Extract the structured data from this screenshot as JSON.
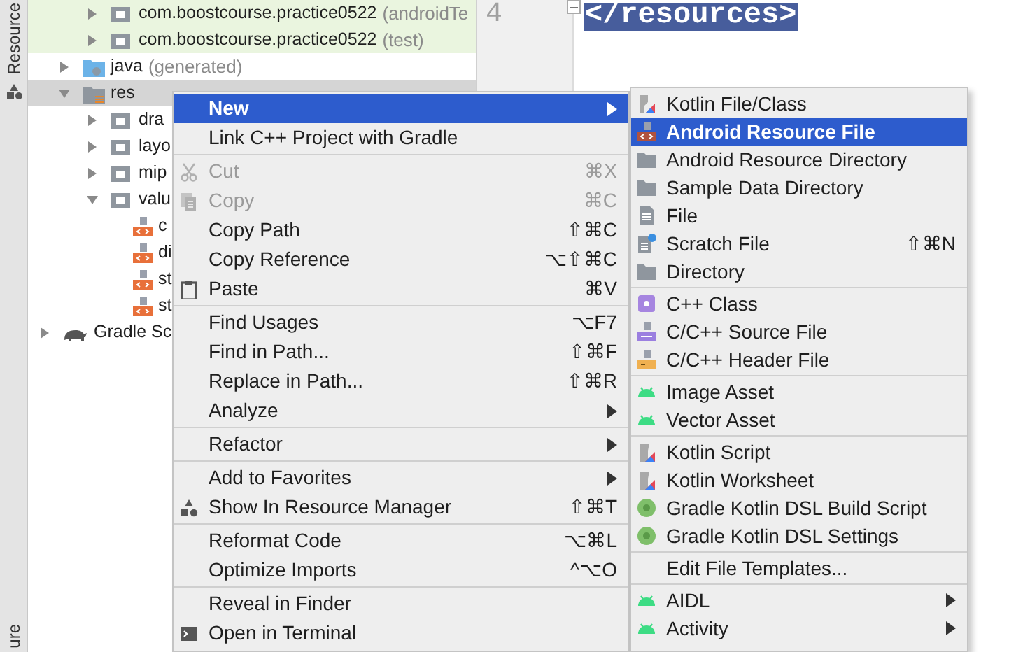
{
  "sidebar_tab": {
    "label": "Resource",
    "bottom_label": "ure"
  },
  "editor": {
    "line_number": "4",
    "code": "</resources>",
    "selected": true
  },
  "project_tree": {
    "java_packages": [
      {
        "label": "com.boostcourse.practice0522",
        "suffix": "(androidTe",
        "kind": "test-package",
        "expanded": false,
        "selected": false
      },
      {
        "label": "com.boostcourse.practice0522",
        "suffix": "(test)",
        "kind": "test-package",
        "expanded": false,
        "selected": false
      }
    ],
    "module_folders": [
      {
        "label": "java",
        "suffix": "(generated)",
        "kind": "generated-folder",
        "expanded": false,
        "selected": false
      },
      {
        "label": "res",
        "kind": "res-folder",
        "expanded": true,
        "selected": true,
        "children": [
          {
            "label": "dra",
            "kind": "folder",
            "expanded": false,
            "selected": false
          },
          {
            "label": "layo",
            "kind": "folder",
            "expanded": false,
            "selected": false
          },
          {
            "label": "mip",
            "kind": "folder",
            "expanded": false,
            "selected": false
          },
          {
            "label": "valu",
            "kind": "folder",
            "expanded": true,
            "selected": false,
            "children": [
              {
                "label": "c",
                "kind": "xml-file",
                "selected": false
              },
              {
                "label": "di",
                "kind": "xml-file",
                "selected": false
              },
              {
                "label": "st",
                "kind": "xml-file",
                "selected": false
              },
              {
                "label": "st",
                "kind": "xml-file",
                "selected": false
              }
            ]
          }
        ]
      }
    ],
    "root_items": [
      {
        "label": "Gradle Sc",
        "kind": "gradle",
        "expanded": false,
        "selected": false
      }
    ]
  },
  "context_menu": {
    "groups": [
      [
        {
          "label": "New",
          "kind": "none",
          "submenu": true,
          "disabled": false,
          "selected": true
        },
        {
          "label": "Link C++ Project with Gradle",
          "kind": "none",
          "submenu": false,
          "disabled": false,
          "selected": false
        }
      ],
      [
        {
          "label": "Cut",
          "kind": "scissors",
          "shortcut": "⌘X",
          "submenu": false,
          "disabled": true,
          "selected": false
        },
        {
          "label": "Copy",
          "kind": "copy",
          "shortcut": "⌘C",
          "submenu": false,
          "disabled": true,
          "selected": false
        },
        {
          "label": "Copy Path",
          "kind": "none",
          "shortcut": "⇧⌘C",
          "submenu": false,
          "disabled": false,
          "selected": false
        },
        {
          "label": "Copy Reference",
          "kind": "none",
          "shortcut": "⌥⇧⌘C",
          "submenu": false,
          "disabled": false,
          "selected": false
        },
        {
          "label": "Paste",
          "kind": "clipboard",
          "shortcut": "⌘V",
          "submenu": false,
          "disabled": false,
          "selected": false
        }
      ],
      [
        {
          "label": "Find Usages",
          "kind": "none",
          "shortcut": "⌥F7",
          "submenu": false,
          "disabled": false,
          "selected": false
        },
        {
          "label": "Find in Path...",
          "kind": "none",
          "shortcut": "⇧⌘F",
          "submenu": false,
          "disabled": false,
          "selected": false
        },
        {
          "label": "Replace in Path...",
          "kind": "none",
          "shortcut": "⇧⌘R",
          "submenu": false,
          "disabled": false,
          "selected": false
        },
        {
          "label": "Analyze",
          "kind": "none",
          "submenu": true,
          "disabled": false,
          "selected": false
        }
      ],
      [
        {
          "label": "Refactor",
          "kind": "none",
          "submenu": true,
          "disabled": false,
          "selected": false
        }
      ],
      [
        {
          "label": "Add to Favorites",
          "kind": "none",
          "submenu": true,
          "disabled": false,
          "selected": false
        },
        {
          "label": "Show In Resource Manager",
          "kind": "shapes",
          "shortcut": "⇧⌘T",
          "submenu": false,
          "disabled": false,
          "selected": false
        }
      ],
      [
        {
          "label": "Reformat Code",
          "kind": "none",
          "shortcut": "⌥⌘L",
          "submenu": false,
          "disabled": false,
          "selected": false
        },
        {
          "label": "Optimize Imports",
          "kind": "none",
          "shortcut": "^⌥O",
          "submenu": false,
          "disabled": false,
          "selected": false
        }
      ],
      [
        {
          "label": "Reveal in Finder",
          "kind": "none",
          "submenu": false,
          "disabled": false,
          "selected": false
        },
        {
          "label": "Open in Terminal",
          "kind": "terminal",
          "submenu": false,
          "disabled": false,
          "selected": false
        }
      ]
    ]
  },
  "submenu": {
    "groups": [
      [
        {
          "label": "Kotlin File/Class",
          "kind": "kotlin",
          "submenu": false,
          "disabled": false,
          "selected": false
        },
        {
          "label": "Android Resource File",
          "kind": "resource-file",
          "submenu": false,
          "disabled": false,
          "selected": true
        },
        {
          "label": "Android Resource Directory",
          "kind": "folder",
          "submenu": false,
          "disabled": false,
          "selected": false
        },
        {
          "label": "Sample Data Directory",
          "kind": "folder",
          "submenu": false,
          "disabled": false,
          "selected": false
        },
        {
          "label": "File",
          "kind": "file",
          "submenu": false,
          "disabled": false,
          "selected": false
        },
        {
          "label": "Scratch File",
          "kind": "scratch",
          "shortcut": "⇧⌘N",
          "submenu": false,
          "disabled": false,
          "selected": false
        },
        {
          "label": "Directory",
          "kind": "folder",
          "submenu": false,
          "disabled": false,
          "selected": false
        }
      ],
      [
        {
          "label": "C++ Class",
          "kind": "cpp-class",
          "submenu": false,
          "disabled": false,
          "selected": false
        },
        {
          "label": "C/C++ Source File",
          "kind": "cpp-source",
          "submenu": false,
          "disabled": false,
          "selected": false
        },
        {
          "label": "C/C++ Header File",
          "kind": "cpp-header",
          "submenu": false,
          "disabled": false,
          "selected": false
        }
      ],
      [
        {
          "label": "Image Asset",
          "kind": "android",
          "submenu": false,
          "disabled": false,
          "selected": false
        },
        {
          "label": "Vector Asset",
          "kind": "android",
          "submenu": false,
          "disabled": false,
          "selected": false
        }
      ],
      [
        {
          "label": "Kotlin Script",
          "kind": "kotlin-script",
          "submenu": false,
          "disabled": false,
          "selected": false
        },
        {
          "label": "Kotlin Worksheet",
          "kind": "kotlin-script",
          "submenu": false,
          "disabled": false,
          "selected": false
        },
        {
          "label": "Gradle Kotlin DSL Build Script",
          "kind": "gradle-circle",
          "submenu": false,
          "disabled": false,
          "selected": false
        },
        {
          "label": "Gradle Kotlin DSL Settings",
          "kind": "gradle-circle",
          "submenu": false,
          "disabled": false,
          "selected": false
        }
      ],
      [
        {
          "label": "Edit File Templates...",
          "kind": "none",
          "submenu": false,
          "disabled": false,
          "selected": false
        }
      ],
      [
        {
          "label": "AIDL",
          "kind": "android",
          "submenu": true,
          "disabled": false,
          "selected": false
        },
        {
          "label": "Activity",
          "kind": "android",
          "submenu": true,
          "disabled": false,
          "selected": false
        }
      ]
    ]
  }
}
